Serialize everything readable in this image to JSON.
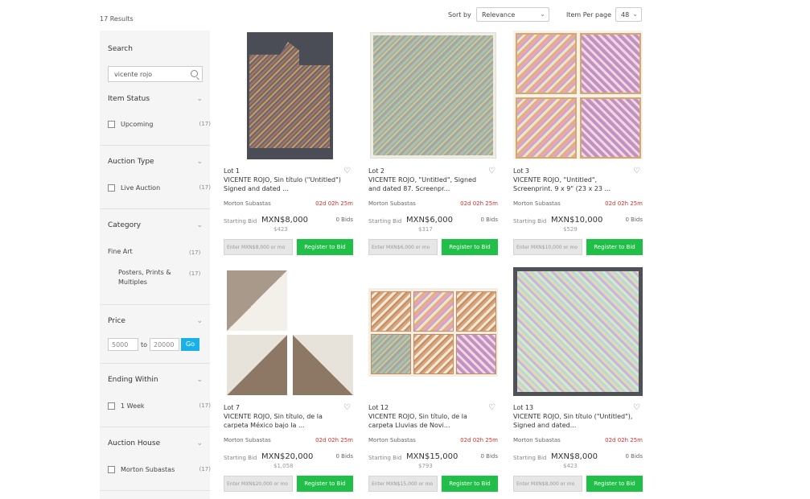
{
  "header": {
    "results_count": "17 Results",
    "sort_label": "Sort by",
    "sort_value": "Relevance",
    "per_page_label": "Item Per page",
    "per_page_value": "48"
  },
  "sidebar": {
    "search_title": "Search",
    "search_value": "vicente rojo",
    "item_status": {
      "title": "Item Status",
      "option": "Upcoming",
      "count": "(17)"
    },
    "auction_type": {
      "title": "Auction Type",
      "option": "Live Auction",
      "count": "(17)"
    },
    "category": {
      "title": "Category",
      "item1": "Fine Art",
      "item1_count": "(17)",
      "item2": "Posters, Prints & Multiples",
      "item2_count": "(17)"
    },
    "price": {
      "title": "Price",
      "min": "5000",
      "to_label": "to",
      "max": "20000",
      "go_label": "Go"
    },
    "ending_within": {
      "title": "Ending Within",
      "option": "1 Week",
      "count": "(17)"
    },
    "auction_house": {
      "title": "Auction House",
      "option": "Morton Subastas",
      "count": "(17)"
    }
  },
  "lots": [
    {
      "lot": "Lot 1",
      "title": "VICENTE ROJO, Sin título (\"Untitled\") Signed and dated ...",
      "house": "Morton Subastas",
      "time": "02d 02h 25m",
      "starting_label": "Starting Bid",
      "bid": "MXN$8,000",
      "bids": "0 Bids",
      "usd": "$423",
      "input_placeholder": "Enter MXN$8,000 or mo",
      "register": "Register to Bid"
    },
    {
      "lot": "Lot 2",
      "title": "VICENTE ROJO, \"Untitled\", Signed and dated 87. Screenpr...",
      "house": "Morton Subastas",
      "time": "02d 02h 25m",
      "starting_label": "Starting Bid",
      "bid": "MXN$6,000",
      "bids": "0 Bids",
      "usd": "$317",
      "input_placeholder": "Enter MXN$6,000 or mo",
      "register": "Register to Bid"
    },
    {
      "lot": "Lot 3",
      "title": "VICENTE ROJO, \"Untitled\", Screenprint. 9 x 9\" (23 x 23 ...",
      "house": "Morton Subastas",
      "time": "02d 02h 25m",
      "starting_label": "Starting Bid",
      "bid": "MXN$10,000",
      "bids": "0 Bids",
      "usd": "$529",
      "input_placeholder": "Enter MXN$10,000 or mo",
      "register": "Register to Bid"
    },
    {
      "lot": "Lot 7",
      "title": "VICENTE ROJO, Sin título, de la carpeta México bajo la ...",
      "house": "Morton Subastas",
      "time": "02d 02h 25m",
      "starting_label": "Starting Bid",
      "bid": "MXN$20,000",
      "bids": "0 Bids",
      "usd": "$1,058",
      "input_placeholder": "Enter MXN$20,000 or mo",
      "register": "Register to Bid"
    },
    {
      "lot": "Lot 12",
      "title": "VICENTE ROJO, Sin título, de la carpeta Lluvias de Novi...",
      "house": "Morton Subastas",
      "time": "02d 02h 25m",
      "starting_label": "Starting Bid",
      "bid": "MXN$15,000",
      "bids": "0 Bids",
      "usd": "$793",
      "input_placeholder": "Enter MXN$15,000 or mo",
      "register": "Register to Bid"
    },
    {
      "lot": "Lot 13",
      "title": "VICENTE ROJO, Sin título (\"Untitled\"), Signed and dated...",
      "house": "Morton Subastas",
      "time": "02d 02h 25m",
      "starting_label": "Starting Bid",
      "bid": "MXN$8,000",
      "bids": "0 Bids",
      "usd": "$423",
      "input_placeholder": "Enter MXN$8,000 or mo",
      "register": "Register to Bid"
    }
  ],
  "colors": {
    "register_button": "#1fbf48",
    "go_button": "#1ab0e8",
    "time_left": "#e02b2b"
  }
}
